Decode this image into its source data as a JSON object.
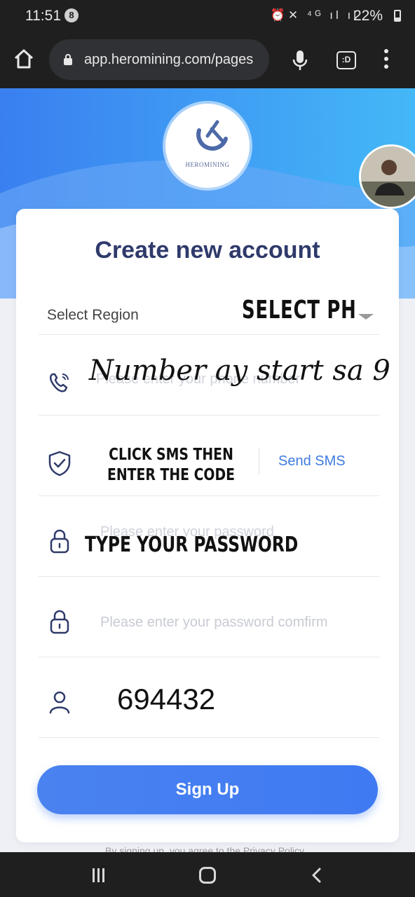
{
  "status_bar": {
    "time": "11:51",
    "notification_count": "8",
    "battery": "22%",
    "icons": [
      "alarm-icon",
      "mute-icon",
      "4g-icon",
      "signal-icon",
      "signal-icon",
      "battery-icon"
    ]
  },
  "browser": {
    "url": "app.heromining.com/pages",
    "tabs_label": ":D"
  },
  "logo": {
    "text": "HEROMINING"
  },
  "form": {
    "title": "Create new account",
    "region": {
      "label": "Select Region",
      "value": "SELECT PH"
    },
    "phone": {
      "placeholder": "Please enter your phone number",
      "overlay": "Number ay start sa 9"
    },
    "code": {
      "overlay": "CLICK SMS THEN ENTER THE CODE",
      "send_sms": "Send SMS"
    },
    "password": {
      "placeholder": "Please enter your password",
      "overlay": "TYPE YOUR PASSWORD"
    },
    "password_confirm": {
      "placeholder": "Please enter your password comfirm"
    },
    "invite": {
      "value": "694432"
    },
    "signup": "Sign Up"
  },
  "footer": {
    "privacy": "By signing up, you agree to the Privacy Policy"
  },
  "colors": {
    "accent": "#3f7af2",
    "title": "#2f3a6b"
  }
}
